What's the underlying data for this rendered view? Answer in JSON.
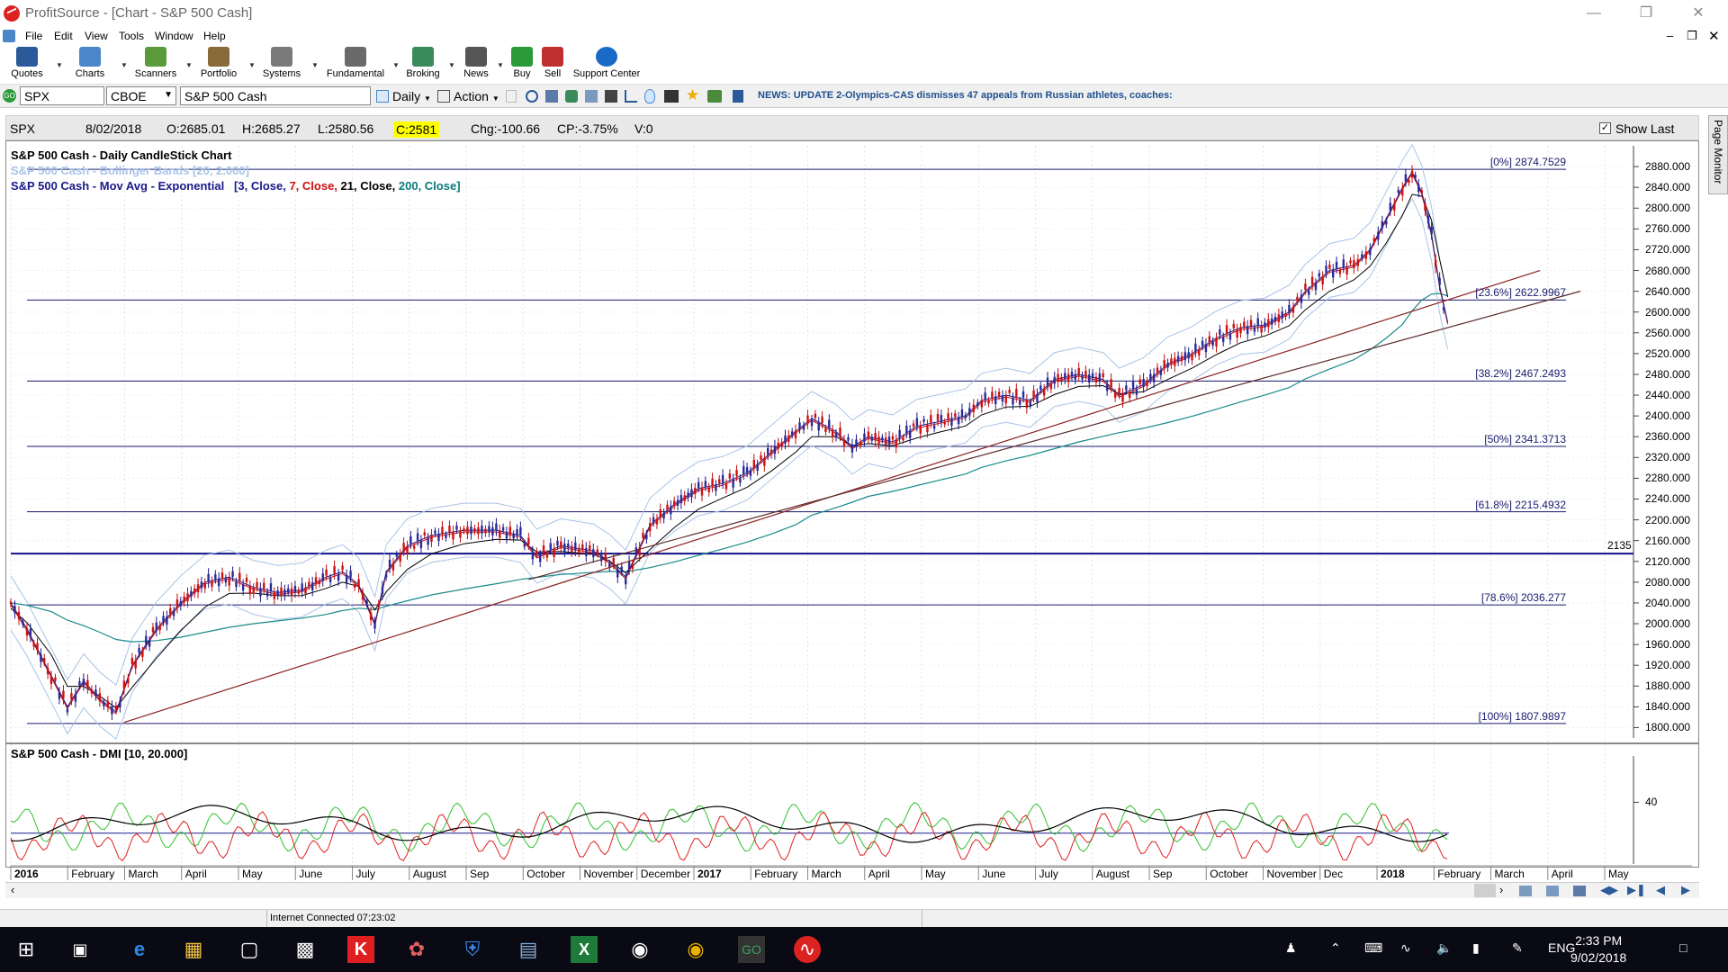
{
  "window": {
    "title": "ProfitSource - [Chart - S&P 500 Cash]"
  },
  "menu": [
    "File",
    "Edit",
    "View",
    "Tools",
    "Window",
    "Help"
  ],
  "toolbar": [
    {
      "label": "Quotes",
      "icon": "quotes-icon",
      "color": "#2a5a9a"
    },
    {
      "label": "Charts",
      "icon": "charts-icon",
      "color": "#4a86c8"
    },
    {
      "label": "Scanners",
      "icon": "scanners-icon",
      "color": "#5a9a3a"
    },
    {
      "label": "Portfolio",
      "icon": "portfolio-icon",
      "color": "#8a6a3a"
    },
    {
      "label": "Systems",
      "icon": "systems-icon",
      "color": "#7a7a7a"
    },
    {
      "label": "Fundamental",
      "icon": "fundamental-icon",
      "color": "#6a6a6a"
    },
    {
      "label": "Broking",
      "icon": "broking-icon",
      "color": "#3a8a5a"
    },
    {
      "label": "News",
      "icon": "news-icon",
      "color": "#555555"
    },
    {
      "label": "Buy",
      "icon": "buy-icon",
      "color": "#2a9a3a"
    },
    {
      "label": "Sell",
      "icon": "sell-icon",
      "color": "#c03030"
    },
    {
      "label": "Support Center",
      "icon": "help-icon",
      "color": "#1a6ac8"
    }
  ],
  "symbol_bar": {
    "symbol": "SPX",
    "exchange": "CBOE",
    "name": "S&P 500 Cash",
    "period": "Daily",
    "action": "Action",
    "news": "NEWS: UPDATE 2-Olympics-CAS dismisses 47 appeals from Russian athletes, coaches:"
  },
  "info_bar": {
    "symbol": "SPX",
    "date": "8/02/2018",
    "open": "O:2685.01",
    "high": "H:2685.27",
    "low": "L:2580.56",
    "close": "C:2581",
    "change": "Chg:-100.66",
    "change_pct": "CP:-3.75%",
    "volume": "V:0",
    "show_last": "Show Last"
  },
  "studies": {
    "main": "S&P 500 Cash - Daily CandleStick Chart",
    "bollinger": "S&P 500 Cash - Bollinger Bands [20, 2.000]",
    "mov_avg_prefix": "S&P 500 Cash - Mov Avg - Exponential",
    "mov_avg_params": [
      {
        "text": "[3, Close,",
        "color": "#1a1a8a"
      },
      {
        "text": "7, Close,",
        "color": "#d01010"
      },
      {
        "text": "21, Close,",
        "color": "#000000"
      },
      {
        "text": "200, Close]",
        "color": "#0a7a7a"
      }
    ],
    "dmi": "S&P 500 Cash - DMI [10, 20.000]"
  },
  "chart_data": {
    "type": "candlestick",
    "y_range": [
      1780,
      2920
    ],
    "y_ticks": [
      "2880.000",
      "2840.000",
      "2800.000",
      "2760.000",
      "2720.000",
      "2680.000",
      "2640.000",
      "2600.000",
      "2560.000",
      "2520.000",
      "2480.000",
      "2440.000",
      "2400.000",
      "2360.000",
      "2320.000",
      "2280.000",
      "2240.000",
      "2200.000",
      "2160.000",
      "2120.000",
      "2080.000",
      "2040.000",
      "2000.000",
      "1960.000",
      "1920.000",
      "1880.000",
      "1840.000",
      "1800.000"
    ],
    "x_labels": [
      {
        "text": "2016",
        "year": true
      },
      {
        "text": "February"
      },
      {
        "text": "March"
      },
      {
        "text": "April"
      },
      {
        "text": "May"
      },
      {
        "text": "June"
      },
      {
        "text": "July"
      },
      {
        "text": "August"
      },
      {
        "text": "Sep"
      },
      {
        "text": "October"
      },
      {
        "text": "November"
      },
      {
        "text": "December"
      },
      {
        "text": "2017",
        "year": true
      },
      {
        "text": "February"
      },
      {
        "text": "March"
      },
      {
        "text": "April"
      },
      {
        "text": "May"
      },
      {
        "text": "June"
      },
      {
        "text": "July"
      },
      {
        "text": "August"
      },
      {
        "text": "Sep"
      },
      {
        "text": "October"
      },
      {
        "text": "November"
      },
      {
        "text": "Dec"
      },
      {
        "text": "2018",
        "year": true
      },
      {
        "text": "February"
      },
      {
        "text": "March"
      },
      {
        "text": "April"
      },
      {
        "text": "May"
      }
    ],
    "fib_levels": [
      {
        "label": "[0%] 2874.7529",
        "value": 2874.7529
      },
      {
        "label": "[23.6%] 2622.9967",
        "value": 2622.9967
      },
      {
        "label": "[38.2%] 2467.2493",
        "value": 2467.2493
      },
      {
        "label": "[50%] 2341.3713",
        "value": 2341.3713
      },
      {
        "label": "[61.8%] 2215.4932",
        "value": 2215.4932
      },
      {
        "label": "[78.6%] 2036.277",
        "value": 2036.277
      },
      {
        "label": "[100%] 1807.9897",
        "value": 1807.9897
      }
    ],
    "horizontal_line": {
      "label": "2135",
      "value": 2135
    },
    "close_path": [
      [
        0,
        2040
      ],
      [
        0.01,
        1990
      ],
      [
        0.025,
        1900
      ],
      [
        0.035,
        1840
      ],
      [
        0.045,
        1890
      ],
      [
        0.055,
        1855
      ],
      [
        0.065,
        1830
      ],
      [
        0.075,
        1920
      ],
      [
        0.09,
        1990
      ],
      [
        0.105,
        2040
      ],
      [
        0.12,
        2080
      ],
      [
        0.135,
        2090
      ],
      [
        0.15,
        2070
      ],
      [
        0.165,
        2060
      ],
      [
        0.18,
        2065
      ],
      [
        0.195,
        2090
      ],
      [
        0.205,
        2100
      ],
      [
        0.215,
        2075
      ],
      [
        0.225,
        2000
      ],
      [
        0.232,
        2100
      ],
      [
        0.245,
        2150
      ],
      [
        0.26,
        2170
      ],
      [
        0.28,
        2180
      ],
      [
        0.3,
        2180
      ],
      [
        0.315,
        2170
      ],
      [
        0.325,
        2130
      ],
      [
        0.34,
        2150
      ],
      [
        0.36,
        2140
      ],
      [
        0.37,
        2120
      ],
      [
        0.38,
        2090
      ],
      [
        0.395,
        2190
      ],
      [
        0.41,
        2230
      ],
      [
        0.425,
        2260
      ],
      [
        0.44,
        2270
      ],
      [
        0.455,
        2290
      ],
      [
        0.47,
        2330
      ],
      [
        0.485,
        2370
      ],
      [
        0.495,
        2395
      ],
      [
        0.51,
        2370
      ],
      [
        0.52,
        2340
      ],
      [
        0.53,
        2360
      ],
      [
        0.545,
        2350
      ],
      [
        0.56,
        2380
      ],
      [
        0.575,
        2390
      ],
      [
        0.59,
        2400
      ],
      [
        0.6,
        2430
      ],
      [
        0.615,
        2440
      ],
      [
        0.63,
        2430
      ],
      [
        0.645,
        2470
      ],
      [
        0.66,
        2480
      ],
      [
        0.675,
        2470
      ],
      [
        0.685,
        2440
      ],
      [
        0.7,
        2460
      ],
      [
        0.715,
        2500
      ],
      [
        0.73,
        2520
      ],
      [
        0.745,
        2550
      ],
      [
        0.76,
        2570
      ],
      [
        0.775,
        2575
      ],
      [
        0.79,
        2600
      ],
      [
        0.8,
        2640
      ],
      [
        0.815,
        2680
      ],
      [
        0.83,
        2690
      ],
      [
        0.84,
        2720
      ],
      [
        0.85,
        2780
      ],
      [
        0.86,
        2840
      ],
      [
        0.866,
        2870
      ],
      [
        0.872,
        2830
      ],
      [
        0.878,
        2750
      ],
      [
        0.883,
        2650
      ],
      [
        0.888,
        2580
      ]
    ],
    "trendlines": [
      {
        "from": [
          0.07,
          1810
        ],
        "to": [
          0.945,
          2680
        ],
        "color": "#8a2020"
      },
      {
        "from": [
          0.32,
          2085
        ],
        "to": [
          0.97,
          2640
        ],
        "color": "#5a2a2a"
      }
    ],
    "dmi": {
      "level_label": "40",
      "baseline_value": 20
    }
  },
  "status": {
    "connection": "Internet Connected 07:23:02"
  },
  "taskbar": {
    "apps": [
      "start-icon",
      "task-view-icon",
      "edge-icon",
      "file-explorer-icon",
      "store-icon",
      "calculator-icon",
      "k-app-icon",
      "bird-app-icon",
      "shield-app-icon",
      "folder-app-icon",
      "excel-icon",
      "camera-app-icon",
      "chrome-icon",
      "go-app-icon",
      "profitsource-icon"
    ],
    "language": "ENG",
    "time": "2:33 PM",
    "date": "9/02/2018"
  },
  "side_tab": "Page Monitor",
  "colors": {
    "fib_line": "#1a1a6e",
    "accent_close": "#ffff00",
    "dmi_plus": "#30c030",
    "dmi_minus": "#e02020",
    "adx": "#000000"
  }
}
